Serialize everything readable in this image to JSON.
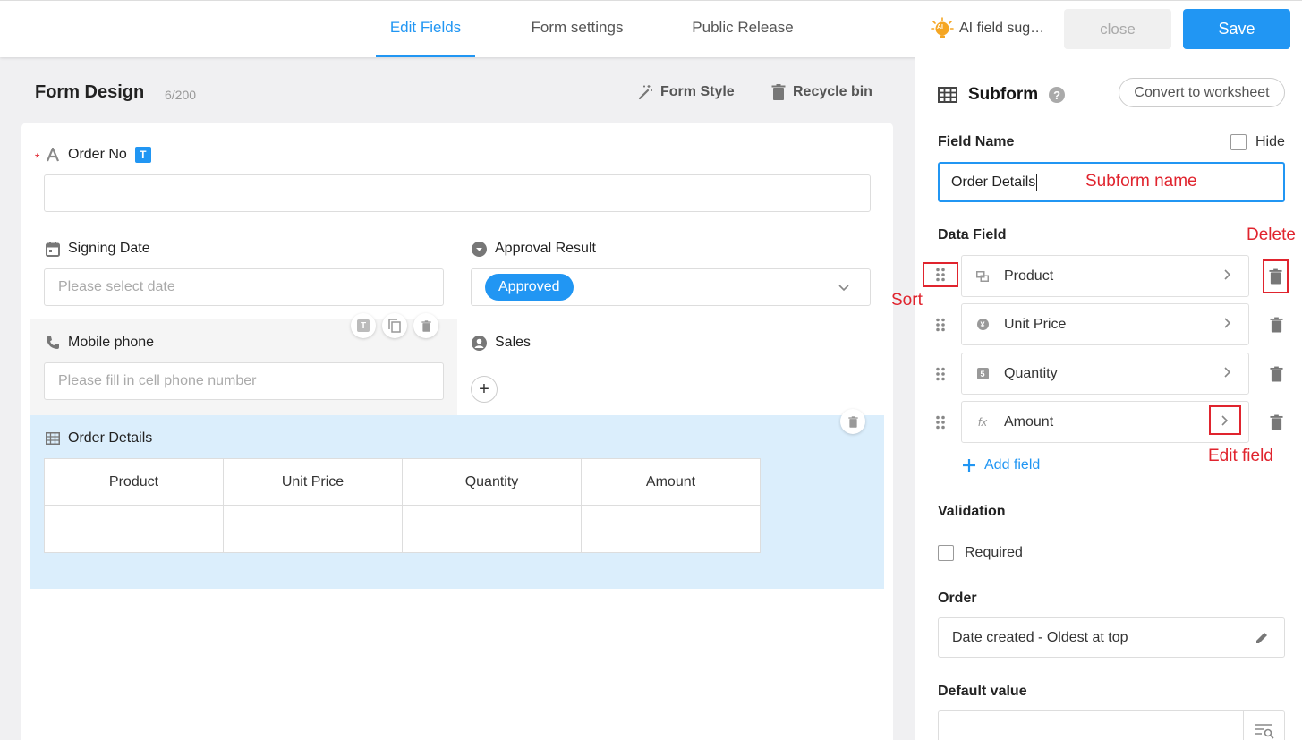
{
  "topbar": {
    "tabs": [
      "Edit Fields",
      "Form settings",
      "Public Release"
    ],
    "ai_label": "AI field sug…",
    "ai_badge": "AI",
    "close_label": "close",
    "save_label": "Save",
    "accent": "#2196f3"
  },
  "left": {
    "title": "Form Design",
    "count": "6/200",
    "form_style": "Form Style",
    "recycle_bin": "Recycle bin",
    "fields": {
      "order_no": {
        "required_mark": "*",
        "label": "Order No",
        "badge": "T"
      },
      "signing_date": {
        "label": "Signing Date",
        "placeholder": "Please select date"
      },
      "approval_result": {
        "label": "Approval Result",
        "value": "Approved"
      },
      "mobile_phone": {
        "label": "Mobile phone",
        "placeholder": "Please fill in cell phone number",
        "mini_badge": "T"
      },
      "sales": {
        "label": "Sales",
        "add": "+"
      },
      "order_details": {
        "label": "Order Details",
        "columns": [
          "Product",
          "Unit Price",
          "Quantity",
          "Amount"
        ]
      }
    }
  },
  "right": {
    "title": "Subform",
    "help": "?",
    "convert_label": "Convert to worksheet",
    "field_name_label": "Field Name",
    "hide_label": "Hide",
    "field_name_value": "Order Details",
    "data_field_label": "Data Field",
    "data_fields": [
      {
        "label": "Product",
        "icon": "relation-icon"
      },
      {
        "label": "Unit Price",
        "icon": "currency-icon",
        "glyph": "¥"
      },
      {
        "label": "Quantity",
        "icon": "number-icon",
        "glyph": "5"
      },
      {
        "label": "Amount",
        "icon": "formula-icon",
        "glyph": "fx"
      }
    ],
    "add_field": "Add field",
    "validation_label": "Validation",
    "required_label": "Required",
    "order_label": "Order",
    "order_value": "Date created - Oldest at top",
    "default_label": "Default value"
  },
  "annotations": {
    "subform_name": "Subform name",
    "delete": "Delete",
    "sort": "Sort",
    "edit_field": "Edit field",
    "color": "#e0242e"
  }
}
